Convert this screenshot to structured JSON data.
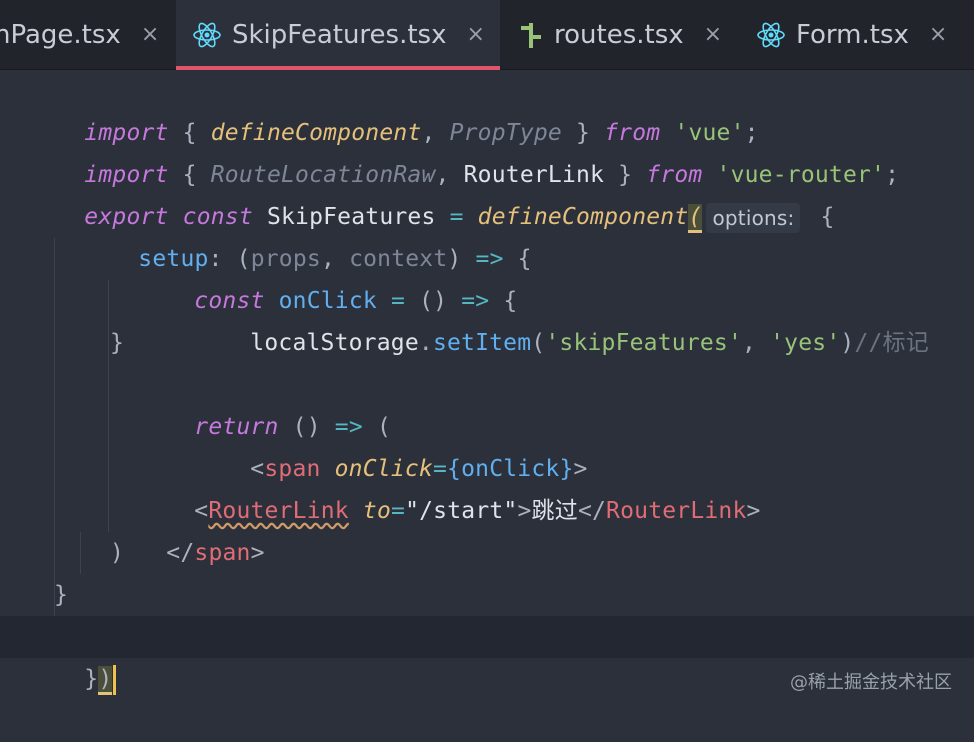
{
  "tabs": [
    {
      "label": "nPage.tsx",
      "icon": "react-icon",
      "close": "×"
    },
    {
      "label": "SkipFeatures.tsx",
      "icon": "react-icon",
      "close": "×"
    },
    {
      "label": "routes.tsx",
      "icon": "routes-icon",
      "close": "×"
    },
    {
      "label": "Form.tsx",
      "icon": "react-icon",
      "close": "×"
    }
  ],
  "colors": {
    "active_tab_underline": "#e0556a",
    "react_icon": "#61dafb",
    "routes_icon": "#98c379",
    "cursor": "#f0c14b"
  },
  "code": {
    "l1": {
      "kw1": "import",
      "p1": " { ",
      "fn": "defineComponent",
      "p2": ", ",
      "ty": "PropType",
      "p3": " } ",
      "kw2": "from",
      "p4": " ",
      "str": "'vue'",
      "p5": ";"
    },
    "l2": {
      "kw1": "import",
      "p1": " { ",
      "ty": "RouteLocationRaw",
      "p2": ", ",
      "id": "RouterLink",
      "p3": " } ",
      "kw2": "from",
      "p4": " ",
      "str": "'vue-router'",
      "p5": ";"
    },
    "l3": {
      "kw1": "export",
      "kw2": " const",
      "id": " SkipFeatures",
      "op": " =",
      "fn": " defineComponent",
      "paren": "(",
      "hint": "options:",
      "brace": " {"
    },
    "l4": {
      "prop": "setup",
      "pun1": ": (",
      "p1": "props",
      "pun2": ", ",
      "p2": "context",
      "pun3": ") ",
      "op": "=>",
      "pun4": " {"
    },
    "l5": {
      "kw": "const",
      "id": " onClick",
      "op": " =",
      "pun1": " () ",
      "arrow": "=>",
      "pun2": " {"
    },
    "l6": {
      "id": "localStorage",
      "dot": ".",
      "meth": "setItem",
      "p1": "(",
      "s1": "'skipFeatures'",
      "p2": ", ",
      "s2": "'yes'",
      "p3": ")",
      "com": "//标记"
    },
    "l7": {
      "pun": "}"
    },
    "l8": {
      "kw": "return",
      "pun1": " () ",
      "arrow": "=>",
      "pun2": " ("
    },
    "l9": {
      "lt": "<",
      "tag": "span",
      "sp": " ",
      "attr": "onClick",
      "eq": "=",
      "ob": "{",
      "val": "onClick",
      "cb": "}",
      "gt": ">"
    },
    "l10": {
      "lt": "<",
      "tag": "RouterLink",
      "sp": " ",
      "attr": "to",
      "eq": "=",
      "str": "\"/start\"",
      "gt": ">",
      "text": "跳过",
      "lt2": "</",
      "tag2": "RouterLink",
      "gt2": ">"
    },
    "l11": {
      "lt": "</",
      "tag": "span",
      "gt": ">"
    },
    "l12": {
      "pun": ")"
    },
    "l13": {
      "pun": "}"
    },
    "l14": {
      "pun1": "}",
      "pun2": ")"
    }
  },
  "watermark": "@稀土掘金技术社区"
}
